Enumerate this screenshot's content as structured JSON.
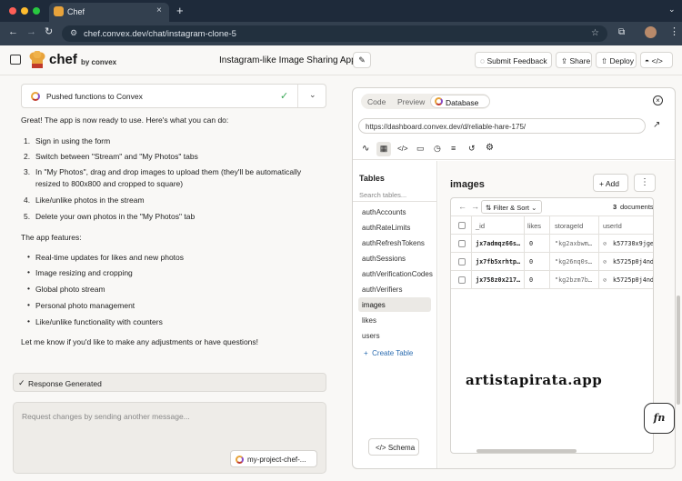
{
  "browser": {
    "tab_title": "Chef",
    "url": "chef.convex.dev/chat/instagram-clone-5"
  },
  "header": {
    "brand": "chef",
    "brand_sub": "by convex",
    "project_title": "Instagram-like Image Sharing App",
    "submit_feedback": "Submit Feedback",
    "share": "Share",
    "deploy": "Deploy"
  },
  "chat": {
    "tool_card": "Pushed functions to Convex",
    "intro": "Great! The app is now ready to use. Here's what you can do:",
    "steps": [
      "Sign in using the form",
      "Switch between \"Stream\" and \"My Photos\" tabs",
      "In \"My Photos\", drag and drop images to upload them (they'll be automatically",
      "resized to 800x800 and cropped to square)",
      "Like/unlike photos in the stream",
      "Delete your own photos in the \"My Photos\" tab"
    ],
    "features_heading": "The app features:",
    "features": [
      "Real-time updates for likes and new photos",
      "Image resizing and cropping",
      "Global photo stream",
      "Personal photo management",
      "Like/unlike functionality with counters"
    ],
    "outro": "Let me know if you'd like to make any adjustments or have questions!",
    "status": "Response Generated",
    "input_placeholder": "Request changes by sending another message...",
    "project_chip": "my-project-chef-..."
  },
  "panel": {
    "tabs": [
      "Code",
      "Preview",
      "Database"
    ],
    "dashboard_url": "https://dashboard.convex.dev/d/reliable-hare-175/",
    "tables_heading": "Tables",
    "search_placeholder": "Search tables...",
    "tables": [
      "authAccounts",
      "authRateLimits",
      "authRefreshTokens",
      "authSessions",
      "authVerificationCodes",
      "authVerifiers",
      "images",
      "likes",
      "users"
    ],
    "selected_table": "images",
    "create_table": "Create Table",
    "schema": "Schema",
    "table_title": "images",
    "add": "Add",
    "filter_sort": "Filter & Sort",
    "doc_count": "3",
    "doc_label": "documents",
    "columns": [
      "_id",
      "likes",
      "storageId",
      "userId"
    ],
    "rows": [
      [
        "jx7admqz66s…",
        "0",
        "\"kg2axbwm…",
        "k57730x9jge"
      ],
      [
        "jx7fb5xrhtp…",
        "0",
        "\"kg26nq0s…",
        "k5725p0j4nd"
      ],
      [
        "jx758z0x217…",
        "0",
        "\"kg2bzm7b…",
        "k5725p0j4nd"
      ]
    ],
    "watermark": "artistapirata.app",
    "fn_button": "fn"
  },
  "colors": {
    "accent": "#e8a33b",
    "link": "#2b6cb0",
    "success": "#3aa757"
  }
}
